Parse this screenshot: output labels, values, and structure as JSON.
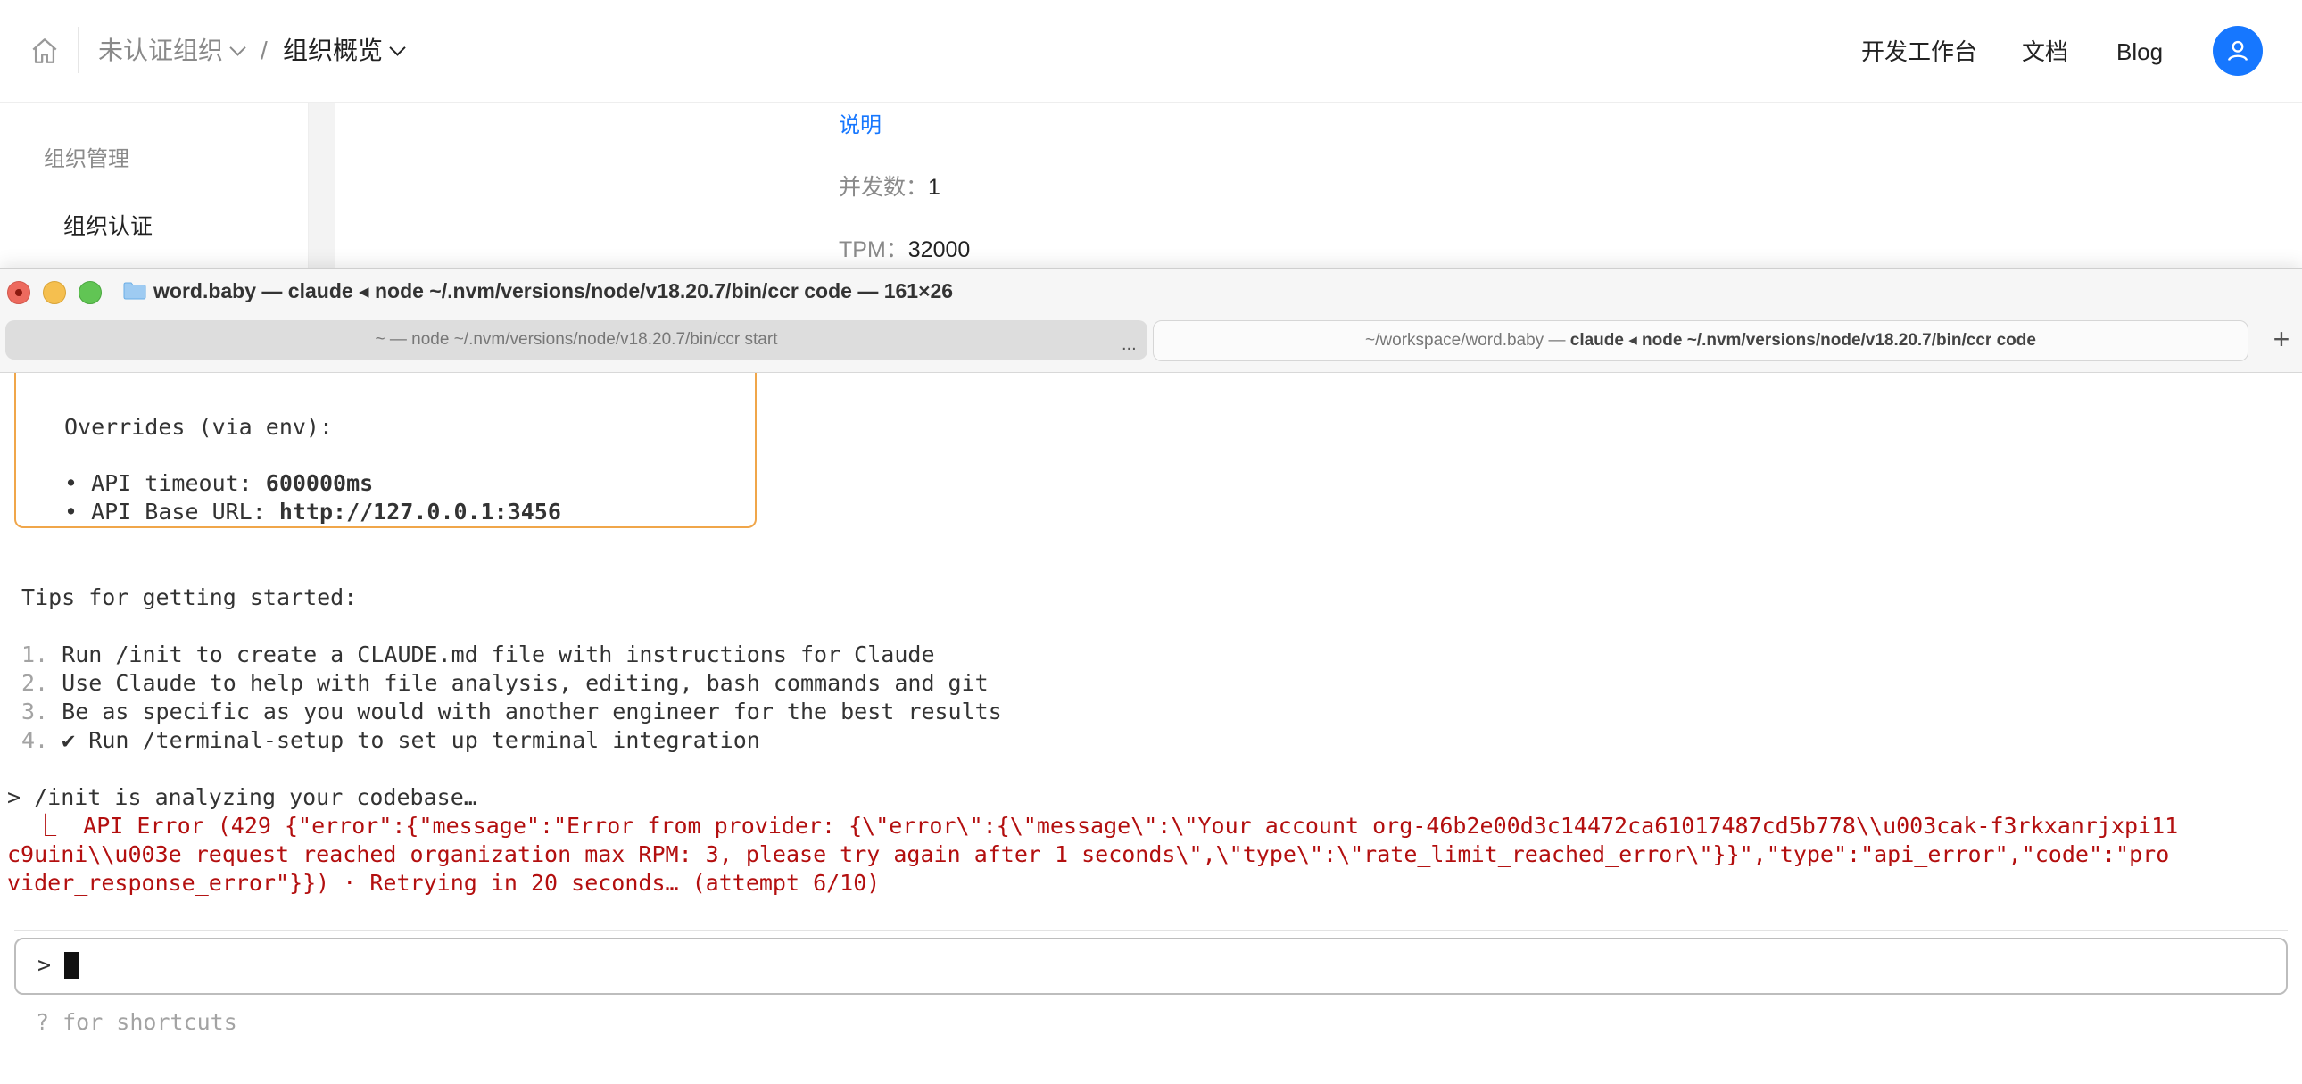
{
  "web": {
    "breadcrumb": {
      "org": "未认证组织",
      "separator": "/",
      "page": "组织概览"
    },
    "top_links": {
      "dev": "开发工作台",
      "docs": "文档",
      "blog": "Blog"
    },
    "sidebar": {
      "heading": "组织管理",
      "item": "组织认证"
    },
    "content": {
      "link": "说明",
      "concurrency_label": "并发数：",
      "concurrency_value": "1",
      "tpm_label": "TPM：",
      "tpm_value": "32000"
    },
    "accent_color": "#1677ff"
  },
  "terminal": {
    "window_title": "word.baby — claude ◂ node ~/.nvm/versions/node/v18.20.7/bin/ccr code — 161×26",
    "tabs": {
      "inactive": "~ — node ~/.nvm/versions/node/v18.20.7/bin/ccr start",
      "more": "...",
      "active_prefix": "~/workspace/word.baby — ",
      "active_bold": "claude ◂ node ~/.nvm/versions/node/v18.20.7/bin/ccr code",
      "add": "+"
    },
    "overrides": {
      "heading": "Overrides (via env):",
      "timeout_label": "• API timeout: ",
      "timeout_value": "600000ms",
      "base_url_label": "• API Base URL: ",
      "base_url_value": "http://127.0.0.1:3456"
    },
    "tips": {
      "heading": "Tips for getting started:",
      "items": [
        {
          "num": "1.",
          "text": " Run /init to create a CLAUDE.md file with instructions for Claude"
        },
        {
          "num": "2.",
          "text": " Use Claude to help with file analysis, editing, bash commands and git"
        },
        {
          "num": "3.",
          "text": " Be as specific as you would with another engineer for the best results"
        },
        {
          "num": "4.",
          "text": " ✔ Run /terminal-setup to set up terminal integration"
        }
      ]
    },
    "init_line": "> /init is analyzing your codebase…",
    "error_lines": [
      "  ⎿  API Error (429 {\"error\":{\"message\":\"Error from provider: {\\\"error\\\":{\\\"message\\\":\\\"Your account org-46b2e00d3c14472ca61017487cd5b778\\\\u003cak-f3rkxanrjxpi11",
      "c9uini\\\\u003e request reached organization max RPM: 3, please try again after 1 seconds\\\",\\\"type\\\":\\\"rate_limit_reached_error\\\"}}\",\"type\":\"api_error\",\"code\":\"pro",
      "vider_response_error\"}}) · Retrying in 20 seconds… (attempt 6/10)"
    ],
    "prompt": ">",
    "shortcuts_hint": "? for shortcuts",
    "box_color": "#f0a64a",
    "error_color": "#b30f0f"
  }
}
